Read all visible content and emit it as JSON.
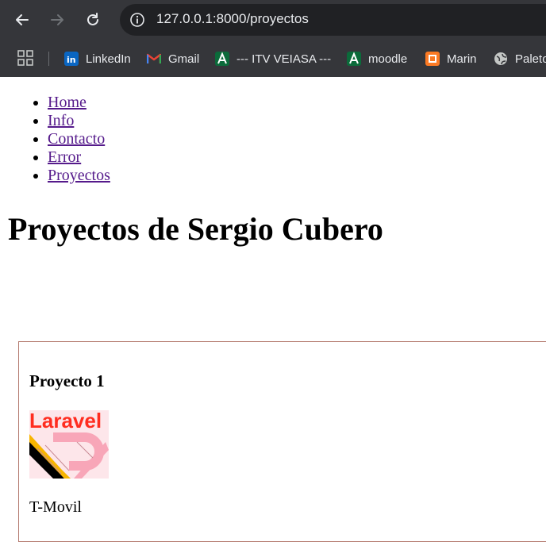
{
  "browser": {
    "url": "127.0.0.1:8000/proyectos",
    "bookmarks": [
      {
        "label": "LinkedIn",
        "icon": "linkedin-icon"
      },
      {
        "label": "Gmail",
        "icon": "gmail-icon"
      },
      {
        "label": "--- ITV VEIASA ---",
        "icon": "itv-icon"
      },
      {
        "label": "moodle",
        "icon": "moodle-icon"
      },
      {
        "label": "Marin",
        "icon": "xampp-icon"
      },
      {
        "label": "Paleto",
        "icon": "globe-icon"
      }
    ]
  },
  "nav": {
    "items": [
      {
        "label": "Home"
      },
      {
        "label": "Info"
      },
      {
        "label": "Contacto"
      },
      {
        "label": "Error"
      },
      {
        "label": "Proyectos"
      }
    ]
  },
  "page": {
    "title": "Proyectos de Sergio Cubero",
    "projects": [
      {
        "name": "Proyecto 1",
        "image_text": "Laravel",
        "description": "T-Movil"
      }
    ]
  },
  "colors": {
    "chrome_bg": "#35363a",
    "omnibox_bg": "#202124",
    "link": "#551a8b",
    "card_border": "#b3776c",
    "laravel_red": "#ff2d20"
  }
}
